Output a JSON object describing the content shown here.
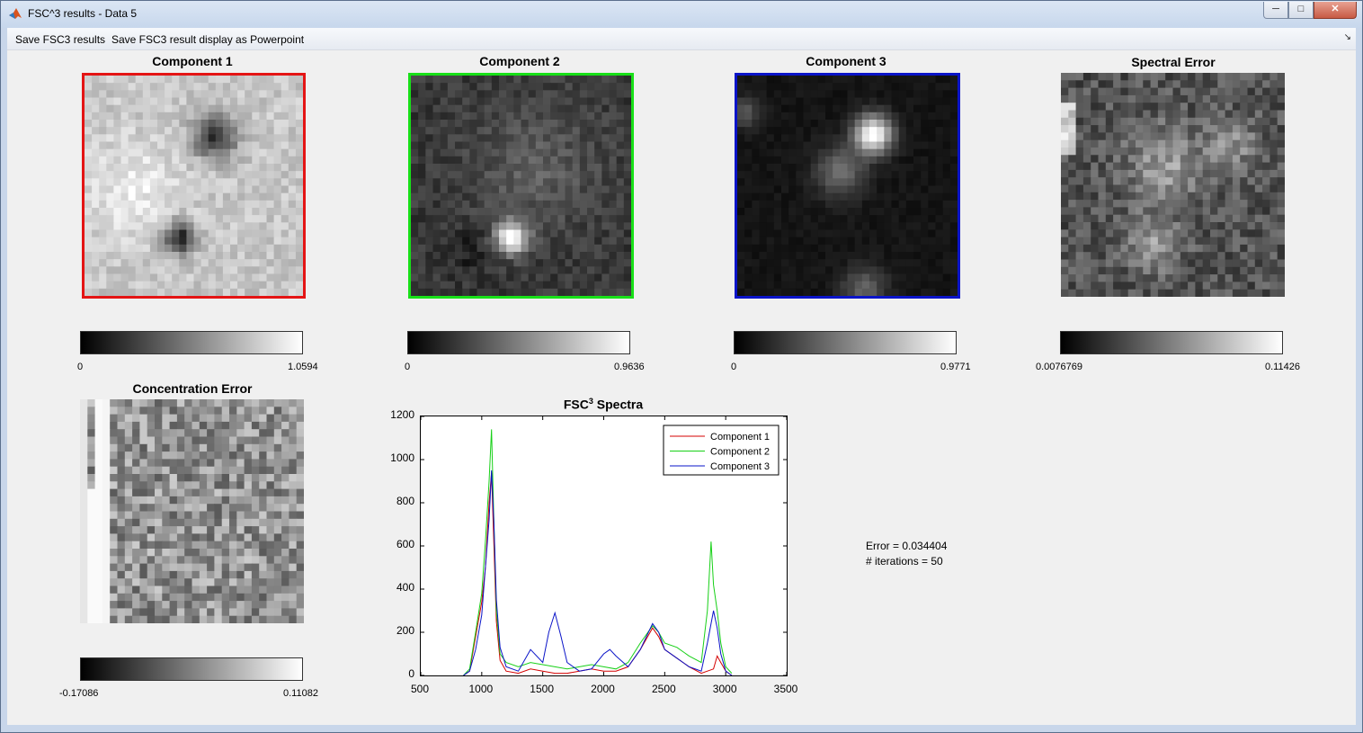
{
  "window": {
    "title": "FSC^3 results - Data 5",
    "controls": [
      "minimize-icon",
      "maximize-icon",
      "close-icon"
    ]
  },
  "menu": {
    "items": [
      {
        "label": "Save FSC3 results"
      },
      {
        "label": "Save FSC3 result display as Powerpoint"
      }
    ],
    "overflow_icon": "chevron-down-icon"
  },
  "panels": [
    {
      "title": "Component 1",
      "frame_color": "#e41414",
      "min": "0",
      "max": "1.0594",
      "pattern": "comp1"
    },
    {
      "title": "Component 2",
      "frame_color": "#18e018",
      "min": "0",
      "max": "0.9636",
      "pattern": "comp2"
    },
    {
      "title": "Component 3",
      "frame_color": "#0a14c8",
      "min": "0",
      "max": "0.9771",
      "pattern": "comp3"
    },
    {
      "title": "Spectral Error",
      "frame_color": "",
      "min": "0.0076769",
      "max": "0.11426",
      "pattern": "spec"
    }
  ],
  "concentration": {
    "title": "Concentration Error",
    "min": "-0.17086",
    "max": "0.11082"
  },
  "chart_data": {
    "type": "line",
    "title": "FSC",
    "title_superscript": "3",
    "title_suffix": " Spectra",
    "xlim": [
      500,
      3500
    ],
    "ylim": [
      0,
      1200
    ],
    "x_ticks": [
      "500",
      "1000",
      "1500",
      "2000",
      "2500",
      "3000",
      "3500"
    ],
    "y_ticks": [
      "0",
      "200",
      "400",
      "600",
      "800",
      "1000",
      "1200"
    ],
    "legend_position": "top-right",
    "series": [
      {
        "name": "Component 1",
        "color": "#d40000",
        "x": [
          850,
          900,
          950,
          1000,
          1030,
          1060,
          1080,
          1100,
          1120,
          1150,
          1200,
          1300,
          1400,
          1500,
          1600,
          1700,
          1800,
          1900,
          2000,
          2100,
          2200,
          2300,
          2400,
          2450,
          2500,
          2600,
          2700,
          2800,
          2900,
          2930,
          2960,
          3000,
          3050
        ],
        "y": [
          0,
          20,
          180,
          340,
          500,
          800,
          940,
          600,
          250,
          70,
          20,
          10,
          30,
          20,
          10,
          10,
          20,
          30,
          20,
          20,
          40,
          120,
          220,
          180,
          120,
          80,
          40,
          10,
          30,
          90,
          60,
          20,
          0
        ]
      },
      {
        "name": "Component 2",
        "color": "#18d018",
        "x": [
          850,
          900,
          950,
          1000,
          1030,
          1060,
          1080,
          1100,
          1120,
          1150,
          1200,
          1300,
          1400,
          1500,
          1600,
          1700,
          1800,
          1900,
          2000,
          2100,
          2200,
          2300,
          2400,
          2450,
          2500,
          2600,
          2700,
          2800,
          2850,
          2880,
          2900,
          2930,
          2960,
          3000,
          3050
        ],
        "y": [
          0,
          30,
          200,
          380,
          620,
          900,
          1140,
          700,
          300,
          100,
          60,
          40,
          60,
          50,
          40,
          30,
          40,
          50,
          40,
          30,
          60,
          150,
          230,
          200,
          150,
          130,
          90,
          60,
          300,
          620,
          420,
          300,
          150,
          40,
          10
        ]
      },
      {
        "name": "Component 3",
        "color": "#0a14c8",
        "x": [
          850,
          900,
          950,
          1000,
          1030,
          1060,
          1080,
          1100,
          1120,
          1150,
          1200,
          1300,
          1400,
          1500,
          1550,
          1600,
          1650,
          1700,
          1800,
          1900,
          2000,
          2050,
          2100,
          2200,
          2300,
          2400,
          2450,
          2500,
          2600,
          2700,
          2800,
          2850,
          2900,
          2930,
          2960,
          3000,
          3050
        ],
        "y": [
          0,
          20,
          120,
          280,
          500,
          720,
          950,
          700,
          350,
          130,
          40,
          20,
          120,
          60,
          200,
          290,
          180,
          60,
          20,
          30,
          100,
          120,
          90,
          40,
          120,
          240,
          200,
          120,
          80,
          40,
          20,
          150,
          300,
          220,
          100,
          20,
          0
        ]
      }
    ]
  },
  "stats": {
    "error": "Error = 0.034404",
    "iterations": "# iterations = 50"
  }
}
